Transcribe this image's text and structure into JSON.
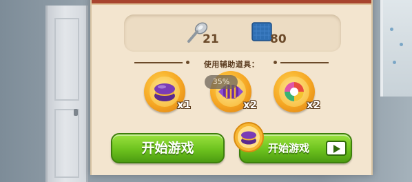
{
  "resources": {
    "spoon": {
      "icon": "spoon-icon",
      "count": "21"
    },
    "cloth": {
      "icon": "blue-cloth-icon",
      "count": "80"
    }
  },
  "boosters_title": "使用辅助道具：",
  "boosters": [
    {
      "icon": "purple-macaron-booster-icon",
      "count": "x1"
    },
    {
      "icon": "wrapped-candy-booster-icon",
      "count": "x2",
      "badge": "35%"
    },
    {
      "icon": "rainbow-swirl-booster-icon",
      "count": "x2"
    }
  ],
  "buttons": {
    "start_label": "开始游戏",
    "ad_start_label": "开始游戏",
    "ad_icon": "video-play-icon",
    "ad_reward_icon": "macaron-badge-icon"
  },
  "colors": {
    "dialog_bg": "#f3e5cf",
    "header": "#a8442e",
    "button_green": "#6dc21e",
    "booster_gold": "#f5a623"
  }
}
